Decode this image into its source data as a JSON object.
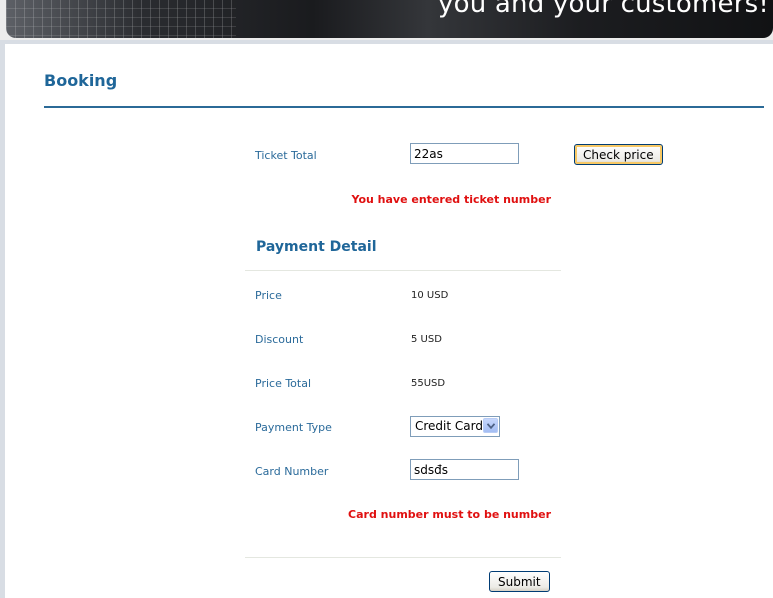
{
  "banner": {
    "tagline": "you and your customers!"
  },
  "page": {
    "title": "Booking"
  },
  "ticket": {
    "label": "Ticket Total",
    "value": "22as",
    "check_price_label": "Check price",
    "message": "You have entered ticket number"
  },
  "payment": {
    "title": "Payment Detail",
    "price_label": "Price",
    "price_value": "10 USD",
    "discount_label": "Discount",
    "discount_value": "5 USD",
    "price_total_label": "Price Total",
    "price_total_value": "55USD",
    "payment_type_label": "Payment Type",
    "payment_type_value": "Credit Card",
    "card_number_label": "Card Number",
    "card_number_value": "sdsđs",
    "card_error": "Card number must to be number"
  },
  "form": {
    "submit_label": "Submit"
  },
  "colors": {
    "heading": "#1f6699",
    "label": "#2a6a9a",
    "error": "#e01010"
  },
  "icons": {
    "select_arrow": "chevron-down-icon"
  }
}
